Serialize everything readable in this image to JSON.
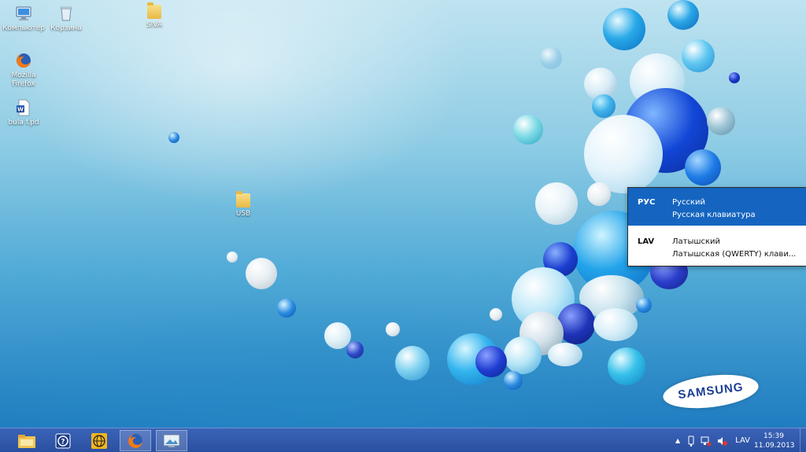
{
  "desktop_icons": [
    {
      "label": "Компьютер",
      "icon": "computer-icon"
    },
    {
      "label": "Корзина",
      "icon": "recycle-bin-icon"
    },
    {
      "label": "SIVA",
      "icon": "folder-icon"
    },
    {
      "label_line1": "Mozilla",
      "label_line2": "Firefox",
      "icon": "firefox-icon"
    },
    {
      "label": "bula f.pd",
      "icon": "word-document-icon"
    },
    {
      "label": "USB",
      "icon": "folder-icon"
    }
  ],
  "language_popup": {
    "items": [
      {
        "code": "РУС",
        "name": "Русский",
        "layout": "Русская клавиатура",
        "selected": true
      },
      {
        "code": "LAV",
        "name": "Латышский",
        "layout": "Латышская (QWERTY) клави...",
        "selected": false
      }
    ]
  },
  "brand": {
    "logo_text": "SAMSUNG",
    "logo_color": "#1b3f94"
  },
  "taskbar": {
    "buttons": [
      {
        "name": "file-explorer-icon"
      },
      {
        "name": "help-icon"
      },
      {
        "name": "globe-app-icon"
      },
      {
        "name": "firefox-icon"
      },
      {
        "name": "screenshot-app-icon"
      }
    ],
    "tray": {
      "show_hidden_label": "▲",
      "language": "LAV",
      "time": "15:39",
      "date": "11.09.2013"
    }
  },
  "colors": {
    "accent": "#1565c0",
    "taskbar": "#2a4fa0"
  }
}
